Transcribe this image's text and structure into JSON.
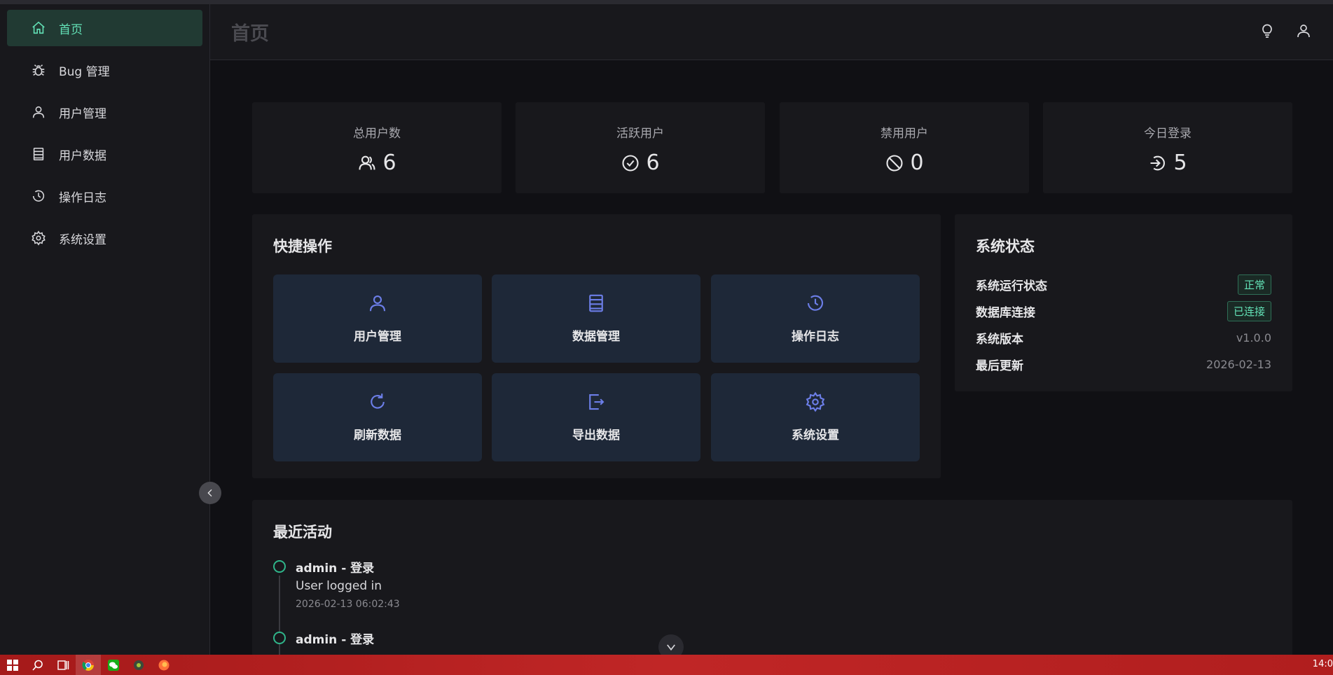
{
  "sidebar": {
    "items": [
      {
        "label": "首页",
        "icon": "home-icon",
        "active": true
      },
      {
        "label": "Bug 管理",
        "icon": "bug-icon"
      },
      {
        "label": "用户管理",
        "icon": "user-icon"
      },
      {
        "label": "用户数据",
        "icon": "database-icon"
      },
      {
        "label": "操作日志",
        "icon": "history-icon"
      },
      {
        "label": "系统设置",
        "icon": "gear-icon"
      }
    ]
  },
  "header": {
    "title": "首页",
    "actions": [
      "lightbulb-icon",
      "user-icon"
    ]
  },
  "stats": [
    {
      "label": "总用户数",
      "value": "6",
      "icon": "users-icon"
    },
    {
      "label": "活跃用户",
      "value": "6",
      "icon": "check-circle-icon"
    },
    {
      "label": "禁用用户",
      "value": "0",
      "icon": "ban-icon"
    },
    {
      "label": "今日登录",
      "value": "5",
      "icon": "login-icon"
    }
  ],
  "quick_actions": {
    "title": "快捷操作",
    "items": [
      {
        "label": "用户管理",
        "icon": "user-icon"
      },
      {
        "label": "数据管理",
        "icon": "database-icon"
      },
      {
        "label": "操作日志",
        "icon": "history-icon"
      },
      {
        "label": "刷新数据",
        "icon": "refresh-icon"
      },
      {
        "label": "导出数据",
        "icon": "export-icon"
      },
      {
        "label": "系统设置",
        "icon": "gear-icon"
      }
    ]
  },
  "system_status": {
    "title": "系统状态",
    "rows": [
      {
        "key": "系统运行状态",
        "value": "正常",
        "badge": true
      },
      {
        "key": "数据库连接",
        "value": "已连接",
        "badge": true
      },
      {
        "key": "系统版本",
        "value": "v1.0.0",
        "badge": false
      },
      {
        "key": "最后更新",
        "value": "2026-02-13",
        "badge": false
      }
    ]
  },
  "recent_activity": {
    "title": "最近活动",
    "items": [
      {
        "head": "admin - 登录",
        "desc": "User logged in",
        "time": "2026-02-13 06:02:43"
      },
      {
        "head": "admin - 登录",
        "desc": "",
        "time": ""
      }
    ]
  },
  "taskbar": {
    "time": "14:0",
    "icons": [
      "windows-start-icon",
      "search-icon",
      "task-view-icon",
      "chrome-icon",
      "wechat-icon",
      "android-icon",
      "firefox-icon"
    ]
  },
  "colors": {
    "accent": "#63e2b7",
    "quick_icon": "#6c7ee8",
    "taskbar": "#c02626"
  }
}
